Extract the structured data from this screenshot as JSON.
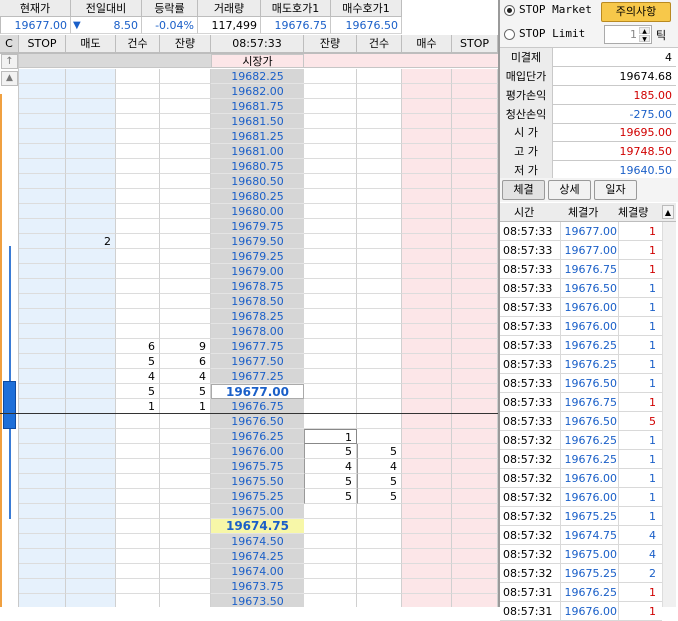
{
  "quote_header": {
    "labels": [
      "현재가",
      "전일대비",
      "등락률",
      "거래량",
      "매도호가1",
      "매수호가1"
    ],
    "current_price": "19677.00",
    "change_arrow": "▼",
    "change": "8.50",
    "change_rate": "-0.04%",
    "volume": "117,499",
    "ask1": "19676.75",
    "bid1": "19676.50"
  },
  "ladder_header": {
    "c_button": "C",
    "cols": [
      "STOP",
      "매도",
      "건수",
      "잔량",
      "08:57:33",
      "잔량",
      "건수",
      "매수",
      "STOP"
    ],
    "open_label": "시장가"
  },
  "ladder": {
    "prices": [
      "19682.25",
      "19682.00",
      "19681.75",
      "19681.50",
      "19681.25",
      "19681.00",
      "19680.75",
      "19680.50",
      "19680.25",
      "19680.00",
      "19679.75",
      "19679.50",
      "19679.25",
      "19679.00",
      "19678.75",
      "19678.50",
      "19678.25",
      "19678.00",
      "19677.75",
      "19677.50",
      "19677.25",
      "19677.00",
      "19676.75",
      "19676.50",
      "19676.25",
      "19676.00",
      "19675.75",
      "19675.50",
      "19675.25",
      "19675.00",
      "19674.75",
      "19674.50",
      "19674.25",
      "19674.00",
      "19673.75",
      "19673.50"
    ],
    "sell_order_qty": {
      "11": "2"
    },
    "sell_count": {
      "18": "6",
      "19": "5",
      "20": "4",
      "21": "5",
      "22": "1"
    },
    "sell_remain": {
      "18": "9",
      "19": "6",
      "20": "4",
      "21": "5",
      "22": "1"
    },
    "buy_remain": {
      "24": "1",
      "25": "5",
      "26": "4",
      "27": "5",
      "28": "5"
    },
    "buy_count": {
      "25": "5",
      "26": "4",
      "27": "5",
      "28": "5"
    },
    "current_index": 21,
    "highlight_index": 30
  },
  "stop_panel": {
    "stop_market": "STOP Market",
    "stop_limit": "STOP Limit",
    "notice_button": "주의사항",
    "tick_value": "1",
    "tick_unit": "틱"
  },
  "position_info": [
    {
      "label": "미결제",
      "value": "4",
      "color": "#000000"
    },
    {
      "label": "매입단가",
      "value": "19674.68",
      "color": "#000000"
    },
    {
      "label": "평가손익",
      "value": "185.00",
      "color": "#d00000"
    },
    {
      "label": "청산손익",
      "value": "-275.00",
      "color": "#1a5fc8"
    }
  ],
  "price_info": [
    {
      "label": "시 가",
      "value": "19695.00",
      "color": "#d00000"
    },
    {
      "label": "고 가",
      "value": "19748.50",
      "color": "#d00000"
    },
    {
      "label": "저 가",
      "value": "19640.50",
      "color": "#1a5fc8"
    }
  ],
  "trade_tabs": [
    "체결",
    "상세",
    "일자"
  ],
  "trade_header": [
    "시간",
    "체결가",
    "체결량"
  ],
  "trades": [
    {
      "time": "08:57:33",
      "price": "19677.00",
      "qty": "1",
      "color": "#d00000"
    },
    {
      "time": "08:57:33",
      "price": "19677.00",
      "qty": "1",
      "color": "#d00000"
    },
    {
      "time": "08:57:33",
      "price": "19676.75",
      "qty": "1",
      "color": "#d00000"
    },
    {
      "time": "08:57:33",
      "price": "19676.50",
      "qty": "1",
      "color": "#1a5fc8"
    },
    {
      "time": "08:57:33",
      "price": "19676.00",
      "qty": "1",
      "color": "#1a5fc8"
    },
    {
      "time": "08:57:33",
      "price": "19676.00",
      "qty": "1",
      "color": "#1a5fc8"
    },
    {
      "time": "08:57:33",
      "price": "19676.25",
      "qty": "1",
      "color": "#1a5fc8"
    },
    {
      "time": "08:57:33",
      "price": "19676.25",
      "qty": "1",
      "color": "#1a5fc8"
    },
    {
      "time": "08:57:33",
      "price": "19676.50",
      "qty": "1",
      "color": "#1a5fc8"
    },
    {
      "time": "08:57:33",
      "price": "19676.75",
      "qty": "1",
      "color": "#d00000"
    },
    {
      "time": "08:57:33",
      "price": "19676.50",
      "qty": "5",
      "color": "#d00000"
    },
    {
      "time": "08:57:32",
      "price": "19676.25",
      "qty": "1",
      "color": "#1a5fc8"
    },
    {
      "time": "08:57:32",
      "price": "19676.25",
      "qty": "1",
      "color": "#1a5fc8"
    },
    {
      "time": "08:57:32",
      "price": "19676.00",
      "qty": "1",
      "color": "#1a5fc8"
    },
    {
      "time": "08:57:32",
      "price": "19676.00",
      "qty": "1",
      "color": "#1a5fc8"
    },
    {
      "time": "08:57:32",
      "price": "19675.25",
      "qty": "1",
      "color": "#1a5fc8"
    },
    {
      "time": "08:57:32",
      "price": "19674.75",
      "qty": "4",
      "color": "#1a5fc8"
    },
    {
      "time": "08:57:32",
      "price": "19675.00",
      "qty": "4",
      "color": "#1a5fc8"
    },
    {
      "time": "08:57:32",
      "price": "19675.25",
      "qty": "2",
      "color": "#1a5fc8"
    },
    {
      "time": "08:57:31",
      "price": "19676.25",
      "qty": "1",
      "color": "#d00000"
    },
    {
      "time": "08:57:31",
      "price": "19676.00",
      "qty": "1",
      "color": "#d00000"
    }
  ],
  "colors": {
    "sell_bg": "#e6f1fc",
    "buy_bg": "#fce6e8",
    "price_bg": "#d6d6d6",
    "current_bg": "#ffffff",
    "highlight_bg": "#f7f7a8",
    "accent_yellow": "#f7c84a"
  }
}
